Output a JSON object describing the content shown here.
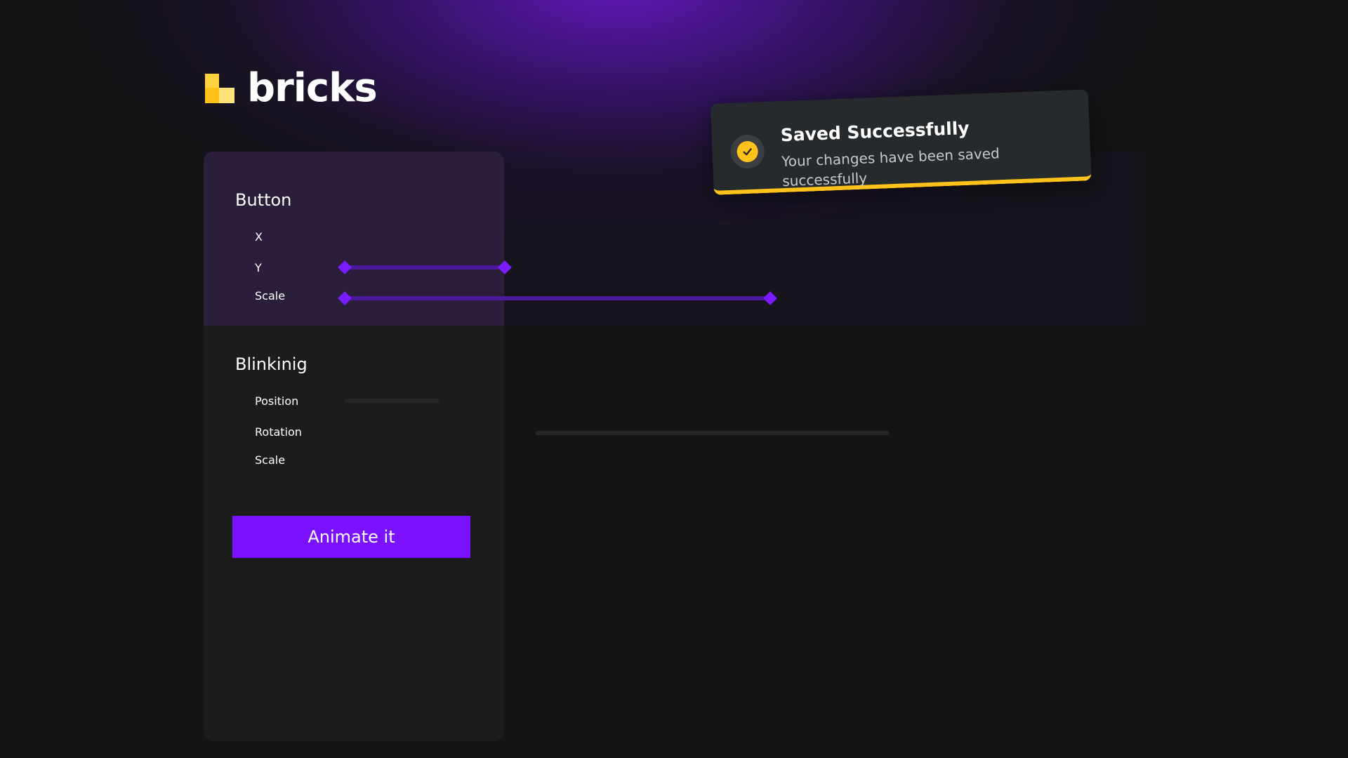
{
  "brand": {
    "name": "bricks",
    "logo_icon": "bricks-logo-icon",
    "colors": {
      "yellow": "#ffd23f",
      "purple": "#7a12ff"
    }
  },
  "panel": {
    "sections": [
      {
        "title": "Button",
        "properties": [
          "X",
          "Y",
          "Scale"
        ]
      },
      {
        "title": "Blinkinig",
        "properties": [
          "Position",
          "Rotation",
          "Scale"
        ]
      }
    ]
  },
  "action": {
    "animate_label": "Animate it"
  },
  "toast": {
    "title": "Saved Successfully",
    "message": "Your changes have been saved successfully",
    "icon": "check-circle-icon",
    "accent": "#ffc21a"
  }
}
